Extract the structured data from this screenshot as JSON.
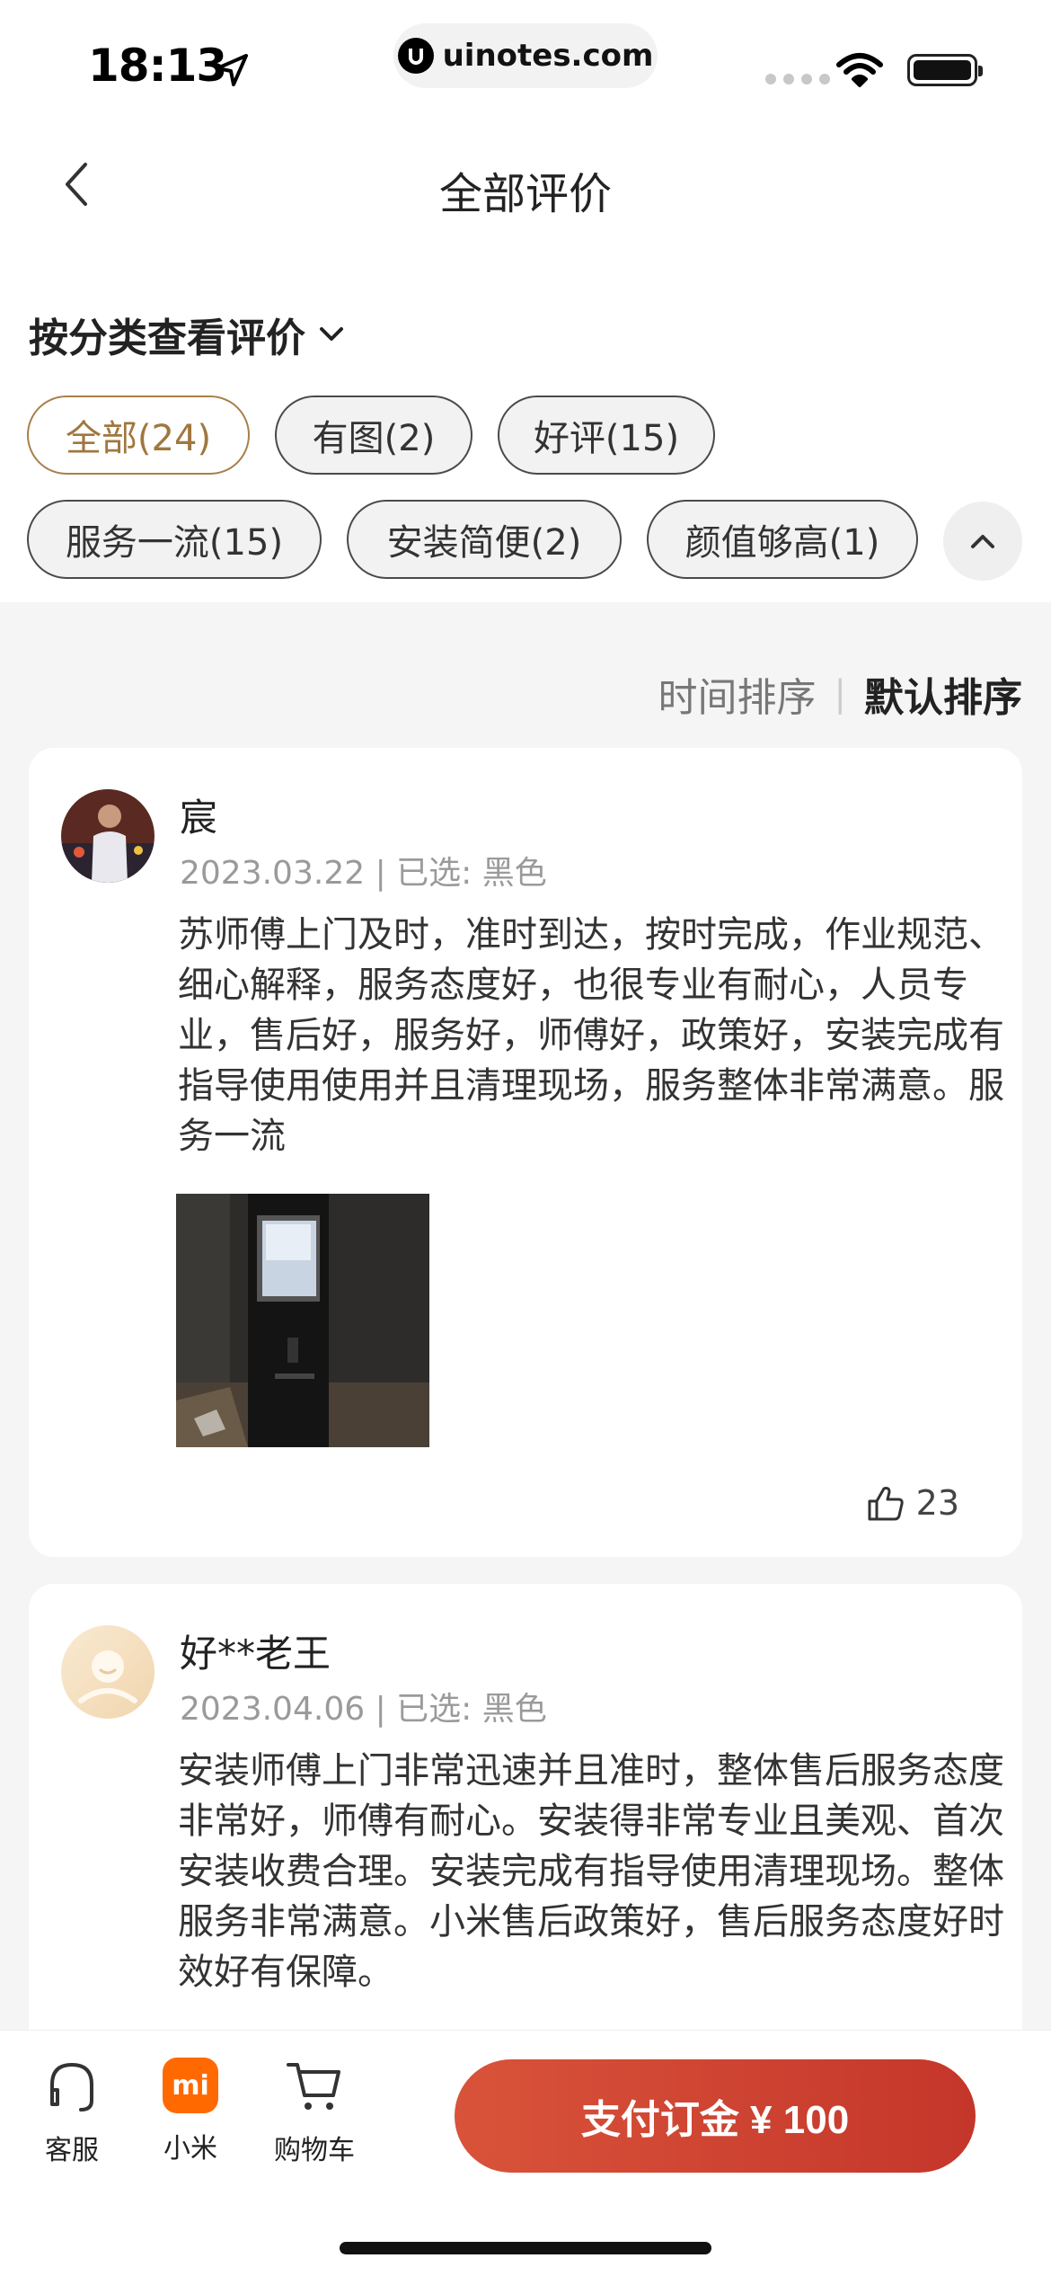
{
  "status_bar": {
    "time": "18:13",
    "url": "uinotes.com"
  },
  "nav": {
    "title": "全部评价"
  },
  "filter": {
    "heading": "按分类查看评价",
    "chips": [
      {
        "label": "全部(24)",
        "active": true
      },
      {
        "label": "有图(2)",
        "active": false
      },
      {
        "label": "好评(15)",
        "active": false
      },
      {
        "label": "服务一流(15)",
        "active": false
      },
      {
        "label": "安装简便(2)",
        "active": false
      },
      {
        "label": "颜值够高(1)",
        "active": false
      }
    ]
  },
  "sort": {
    "time_label": "时间排序",
    "separator": "|",
    "default_label": "默认排序"
  },
  "reviews": [
    {
      "user": "宸",
      "meta": "2023.03.22 | 已选: 黑色",
      "text": "苏师傅上门及时，准时到达，按时完成，作业规范、细心解释，服务态度好，也很专业有耐心，人员专业，售后好，服务好，师傅好，政策好，安装完成有指导使用使用并且清理现场，服务整体非常满意。服务一流",
      "likes": "23",
      "has_photo": true
    },
    {
      "user": "好**老王",
      "meta": "2023.04.06 | 已选: 黑色",
      "text": "安装师傅上门非常迅速并且准时，整体售后服务态度非常好，师傅有耐心。安装得非常专业且美观、首次安装收费合理。安装完成有指导使用清理现场。整体服务非常满意。小米售后政策好，售后服务态度好时效好有保障。"
    }
  ],
  "bottom_bar": {
    "service_label": "客服",
    "mi_label": "小米",
    "mi_logo_text": "mi",
    "cart_label": "购物车",
    "pay_label": "支付订金 ¥ 100"
  },
  "colors": {
    "accent": "#a0773f",
    "pay_button": "#cf4431",
    "mi_orange": "#ff6900"
  }
}
